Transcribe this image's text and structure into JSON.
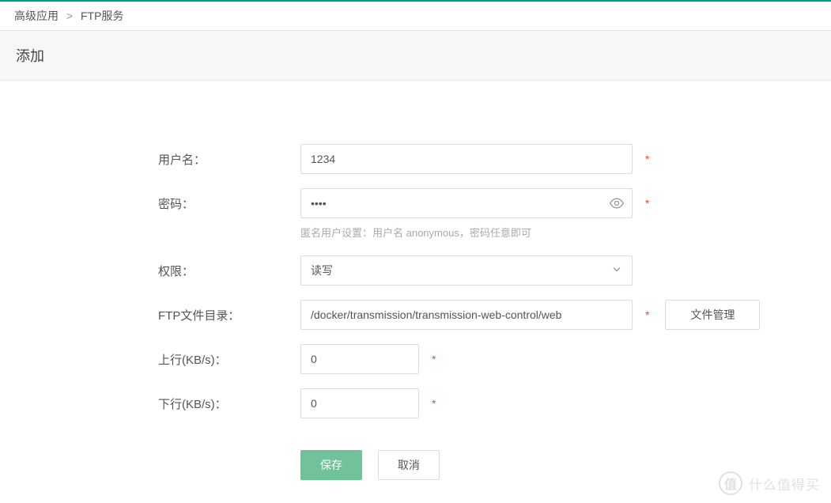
{
  "breadcrumb": {
    "level1": "高级应用",
    "level2": "FTP服务"
  },
  "page_title": "添加",
  "form": {
    "username": {
      "label": "用户名：",
      "value": "1234"
    },
    "password": {
      "label": "密码：",
      "value": "••••",
      "hint": "匿名用户设置：用户名 anonymous，密码任意即可"
    },
    "permission": {
      "label": "权限：",
      "selected": "读写"
    },
    "ftp_dir": {
      "label": "FTP文件目录：",
      "value": "/docker/transmission/transmission-web-control/web",
      "file_manage_label": "文件管理"
    },
    "uplink": {
      "label": "上行(KB/s)：",
      "value": "0"
    },
    "downlink": {
      "label": "下行(KB/s)：",
      "value": "0"
    }
  },
  "buttons": {
    "save": "保存",
    "cancel": "取消"
  },
  "required_mark": "*",
  "watermark": {
    "badge": "值",
    "text": "什么值得买"
  }
}
